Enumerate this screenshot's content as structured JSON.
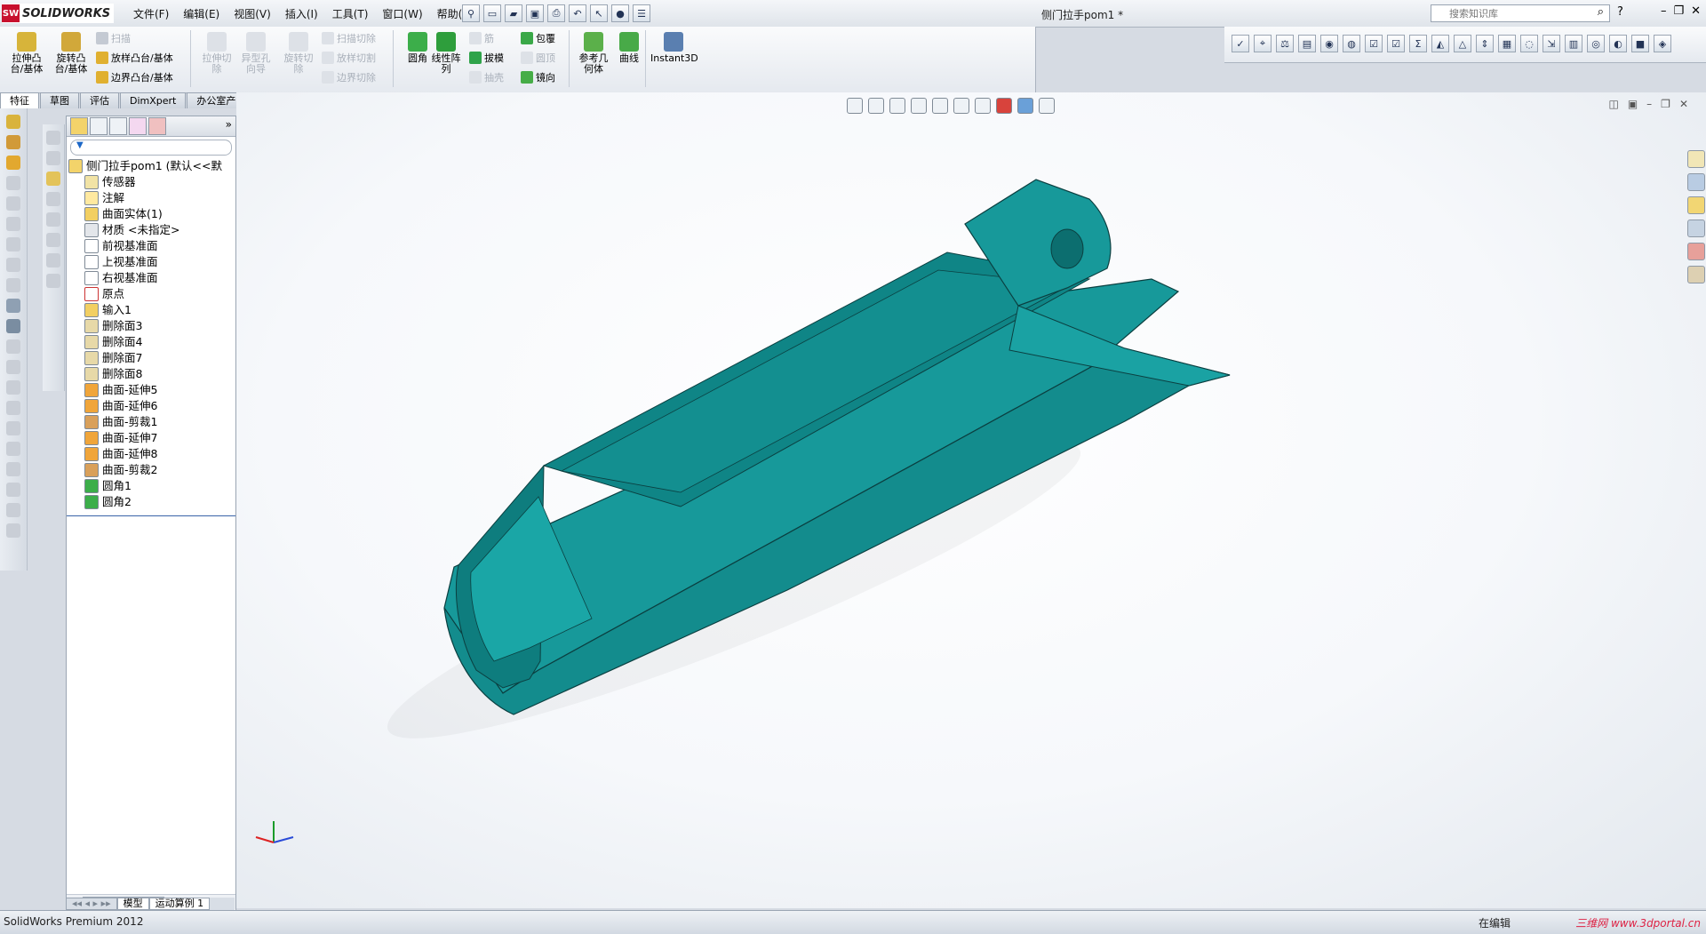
{
  "app": {
    "logo_text": "SOLIDWORKS",
    "document_title": "侧门拉手pom1 *",
    "menus": [
      "文件(F)",
      "编辑(E)",
      "视图(V)",
      "插入(I)",
      "工具(T)",
      "窗口(W)",
      "帮助(H)"
    ],
    "search_placeholder": "搜索知识库"
  },
  "ribbon": {
    "extrude_boss": "拉伸凸\n台/基体",
    "revolve_boss": "旋转凸\n台/基体",
    "sweep": "扫描",
    "loft": "放样凸台/基体",
    "boundary": "边界凸台/基体",
    "extrude_cut": "拉伸切\n除",
    "hole_wizard": "异型孔\n向导",
    "revolve_cut": "旋转切\n除",
    "sweep_cut": "扫描切除",
    "loft_cut": "放样切割",
    "boundary_cut": "边界切除",
    "fillet": "圆角",
    "linear_pattern": "线性阵\n列",
    "rib": "筋",
    "draft": "拔模",
    "shell": "抽壳",
    "wrap": "包覆",
    "dome": "圆顶",
    "mirror": "镜向",
    "ref_geometry": "参考几\n何体",
    "curves": "曲线",
    "instant3d": "Instant3D"
  },
  "tabs": [
    "特征",
    "草图",
    "评估",
    "DimXpert",
    "办公室产品"
  ],
  "feature_tree": {
    "root": "侧门拉手pom1 (默认<<默",
    "items": [
      "传感器",
      "注解",
      "曲面实体(1)",
      "材质 <未指定>",
      "前视基准面",
      "上视基准面",
      "右视基准面",
      "原点",
      "输入1",
      "删除面3",
      "删除面4",
      "删除面7",
      "删除面8",
      "曲面-延伸5",
      "曲面-延伸6",
      "曲面-剪裁1",
      "曲面-延伸7",
      "曲面-延伸8",
      "曲面-剪裁2",
      "圆角1",
      "圆角2"
    ],
    "bottom_tabs": [
      "模型",
      "运动算例 1"
    ]
  },
  "status": {
    "left": "SolidWorks Premium 2012",
    "right": "在编辑",
    "watermark": "三维网 www.3dportal.cn"
  },
  "colors": {
    "model_fill": "#17999a",
    "model_dark": "#0e7d7e",
    "model_edge": "#0b3f40"
  }
}
